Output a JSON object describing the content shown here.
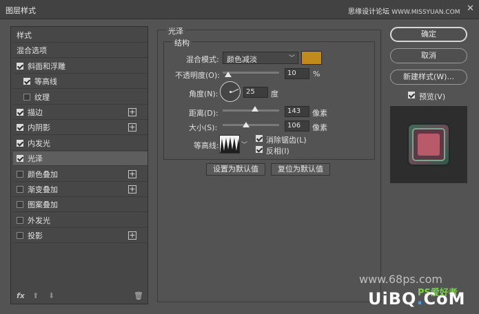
{
  "window": {
    "title": "图层样式",
    "site": "思缘设计论坛",
    "site_url": "WWW.MISSYUAN.COM",
    "close": "✕"
  },
  "left_panel": {
    "items": [
      {
        "label": "样式",
        "checkbox": false,
        "checked": false,
        "plus": false,
        "indent": false
      },
      {
        "label": "混合选项",
        "checkbox": false,
        "checked": false,
        "plus": false,
        "indent": false
      },
      {
        "label": "斜面和浮雕",
        "checkbox": true,
        "checked": true,
        "plus": false,
        "indent": false
      },
      {
        "label": "等高线",
        "checkbox": true,
        "checked": true,
        "plus": false,
        "indent": true
      },
      {
        "label": "纹理",
        "checkbox": true,
        "checked": false,
        "plus": false,
        "indent": true
      },
      {
        "label": "描边",
        "checkbox": true,
        "checked": true,
        "plus": true,
        "indent": false
      },
      {
        "label": "内阴影",
        "checkbox": true,
        "checked": true,
        "plus": true,
        "indent": false
      },
      {
        "label": "内发光",
        "checkbox": true,
        "checked": true,
        "plus": false,
        "indent": false
      },
      {
        "label": "光泽",
        "checkbox": true,
        "checked": true,
        "plus": false,
        "indent": false,
        "selected": true
      },
      {
        "label": "颜色叠加",
        "checkbox": true,
        "checked": false,
        "plus": true,
        "indent": false
      },
      {
        "label": "渐变叠加",
        "checkbox": true,
        "checked": false,
        "plus": true,
        "indent": false
      },
      {
        "label": "图案叠加",
        "checkbox": true,
        "checked": false,
        "plus": false,
        "indent": false
      },
      {
        "label": "外发光",
        "checkbox": true,
        "checked": false,
        "plus": false,
        "indent": false
      },
      {
        "label": "投影",
        "checkbox": true,
        "checked": false,
        "plus": true,
        "indent": false
      }
    ],
    "footer": {
      "fx": "fx",
      "up": "⬆",
      "down": "⬇",
      "trash": "🗑"
    }
  },
  "satin": {
    "section_title": "光泽",
    "structure_title": "结构",
    "blend_mode_label": "混合模式:",
    "blend_mode_value": "颜色减淡",
    "color": "#c08a1c",
    "opacity_label": "不透明度(O):",
    "opacity_value": "10",
    "opacity_unit": "%",
    "opacity_fraction": 0.1,
    "angle_label": "角度(N):",
    "angle_value": "25",
    "angle_unit": "度",
    "distance_label": "距离(D):",
    "distance_value": "143",
    "distance_unit": "像素",
    "distance_fraction": 0.57,
    "size_label": "大小(S):",
    "size_value": "106",
    "size_unit": "像素",
    "size_fraction": 0.42,
    "contour_label": "等高线:",
    "antialias_label": "消除锯齿(L)",
    "antialias_checked": true,
    "invert_label": "反相(I)",
    "invert_checked": true,
    "default_button": "设置为默认值",
    "reset_button": "复位为默认值"
  },
  "side": {
    "ok": "确定",
    "cancel": "取消",
    "new_style": "新建样式(W)...",
    "preview_label": "预览(V)",
    "preview_checked": true
  },
  "watermarks": {
    "w1": "www.68ps.com",
    "w2a": "UiBQ",
    "w2b": ".",
    "w2c": "CoM",
    "w3": "PS爱好者"
  }
}
